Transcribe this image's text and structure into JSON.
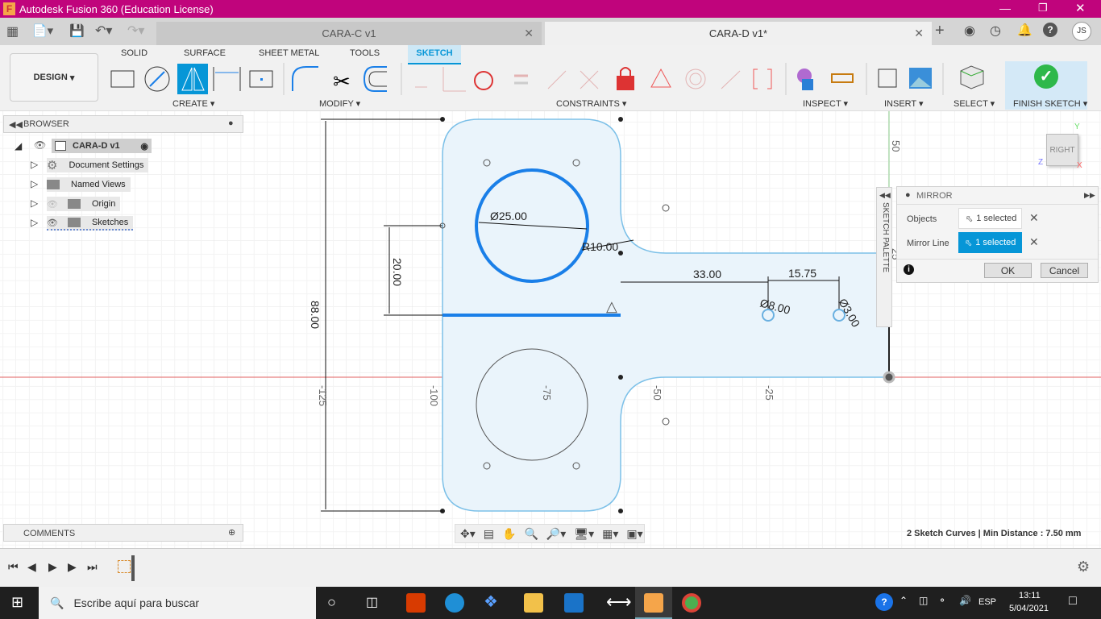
{
  "window": {
    "title": "Autodesk Fusion 360 (Education License)"
  },
  "tabs": [
    {
      "label": "CARA-C v1",
      "active": false
    },
    {
      "label": "CARA-D v1*",
      "active": true
    }
  ],
  "user_initials": "JS",
  "toolbar": {
    "workspace": "DESIGN",
    "tabs": [
      "SOLID",
      "SURFACE",
      "SHEET METAL",
      "TOOLS",
      "SKETCH"
    ],
    "active_tab": "SKETCH",
    "groups": [
      "CREATE",
      "MODIFY",
      "CONSTRAINTS",
      "INSPECT",
      "INSERT",
      "SELECT",
      "FINISH SKETCH"
    ]
  },
  "browser": {
    "title": "BROWSER",
    "root": "CARA-D v1",
    "items": [
      "Document Settings",
      "Named Views",
      "Origin",
      "Sketches"
    ]
  },
  "comments": {
    "title": "COMMENTS"
  },
  "sketch_palette": {
    "label": "SKETCH PALETTE"
  },
  "mirror": {
    "title": "MIRROR",
    "objects_label": "Objects",
    "objects_value": "1 selected",
    "line_label": "Mirror Line",
    "line_value": "1 selected",
    "ok": "OK",
    "cancel": "Cancel"
  },
  "dimensions": {
    "d1": "Ø25.00",
    "r1": "R10.00",
    "h1": "20.00",
    "h2": "88.00",
    "w1": "33.00",
    "w2": "15.75",
    "d2": "Ø8.00",
    "d3": "Ø3.00"
  },
  "axis_labels": {
    "x": [
      "-125",
      "-100",
      "-75",
      "-50",
      "-25"
    ],
    "y": [
      "50",
      "25"
    ]
  },
  "viewcube": {
    "face": "RIGHT",
    "y": "Y",
    "z": "Z",
    "x": "X"
  },
  "status": "2 Sketch Curves | Min Distance : 7.50 mm",
  "taskbar": {
    "search_placeholder": "Escribe aquí para buscar",
    "lang": "ESP",
    "time": "13:11",
    "date": "5/04/2021"
  },
  "colors": {
    "titlebar": "#c0047c",
    "accent": "#0696d7",
    "sketch_fill": "#eaf4fb",
    "selected": "#1a7fe8"
  }
}
